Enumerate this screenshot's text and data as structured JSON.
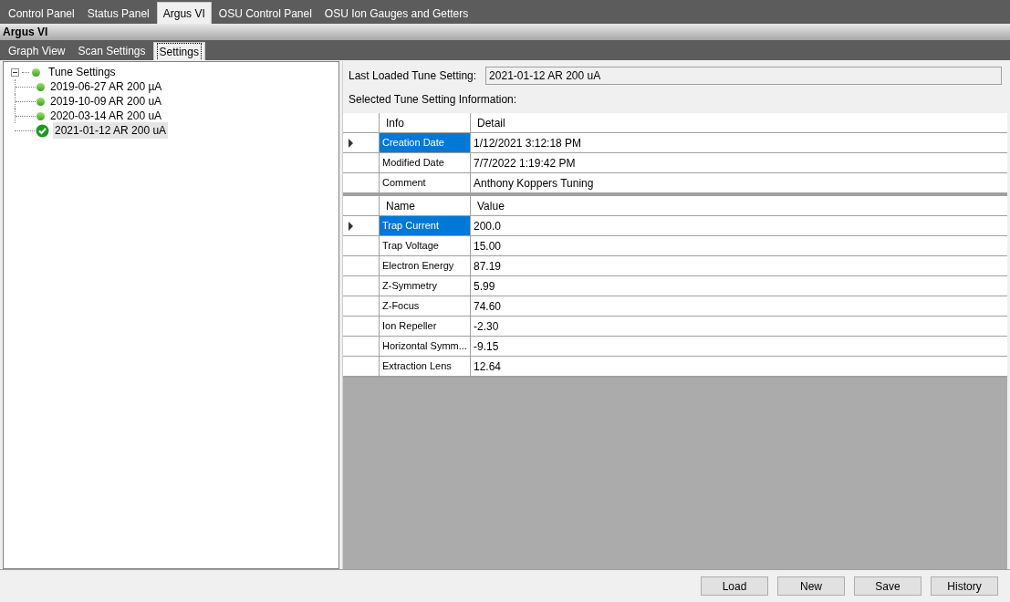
{
  "main_tabs": [
    {
      "label": "Control Panel",
      "selected": false
    },
    {
      "label": "Status Panel",
      "selected": false
    },
    {
      "label": "Argus VI",
      "selected": true
    },
    {
      "label": "OSU Control Panel",
      "selected": false
    },
    {
      "label": "OSU Ion Gauges and Getters",
      "selected": false
    }
  ],
  "panel_title": "Argus VI",
  "sub_tabs": [
    {
      "label": "Graph View",
      "selected": false
    },
    {
      "label": "Scan Settings",
      "selected": false
    },
    {
      "label": "Settings",
      "selected": true
    }
  ],
  "tree": {
    "label": "Tune Settings",
    "expanded": true,
    "children": [
      {
        "label": "2019-06-27 AR 200 µA",
        "loaded": false,
        "selected": false
      },
      {
        "label": "2019-10-09 AR 200 uA",
        "loaded": false,
        "selected": false
      },
      {
        "label": "2020-03-14 AR 200 uA",
        "loaded": false,
        "selected": false
      },
      {
        "label": "2021-01-12 AR 200 uA",
        "loaded": true,
        "selected": true
      }
    ]
  },
  "last_loaded": {
    "label": "Last Loaded Tune Setting:",
    "value": "2021-01-12 AR 200 uA"
  },
  "info_caption": "Selected Tune Setting Information:",
  "info_grid": {
    "columns": [
      "Info",
      "Detail"
    ],
    "rows": [
      {
        "cells": [
          "Creation Date",
          "1/12/2021 3:12:18 PM"
        ],
        "current": true,
        "selected": true
      },
      {
        "cells": [
          "Modified Date",
          "7/7/2022 1:19:42 PM"
        ],
        "current": false,
        "selected": false
      },
      {
        "cells": [
          "Comment",
          "Anthony Koppers Tuning"
        ],
        "current": false,
        "selected": false
      }
    ]
  },
  "values_grid": {
    "columns": [
      "Name",
      "Value"
    ],
    "rows": [
      {
        "cells": [
          "Trap Current",
          "200.0"
        ],
        "current": true,
        "selected": true
      },
      {
        "cells": [
          "Trap Voltage",
          "15.00"
        ],
        "current": false,
        "selected": false
      },
      {
        "cells": [
          "Electron Energy",
          "87.19"
        ],
        "current": false,
        "selected": false
      },
      {
        "cells": [
          "Z-Symmetry",
          "5.99"
        ],
        "current": false,
        "selected": false
      },
      {
        "cells": [
          "Z-Focus",
          "74.60"
        ],
        "current": false,
        "selected": false
      },
      {
        "cells": [
          "Ion Repeller",
          "-2.30"
        ],
        "current": false,
        "selected": false
      },
      {
        "cells": [
          "Horizontal Symm...",
          "-9.15"
        ],
        "current": false,
        "selected": false
      },
      {
        "cells": [
          "Extraction Lens",
          "12.64"
        ],
        "current": false,
        "selected": false
      }
    ]
  },
  "buttons": [
    "Load",
    "New",
    "Save",
    "History"
  ]
}
